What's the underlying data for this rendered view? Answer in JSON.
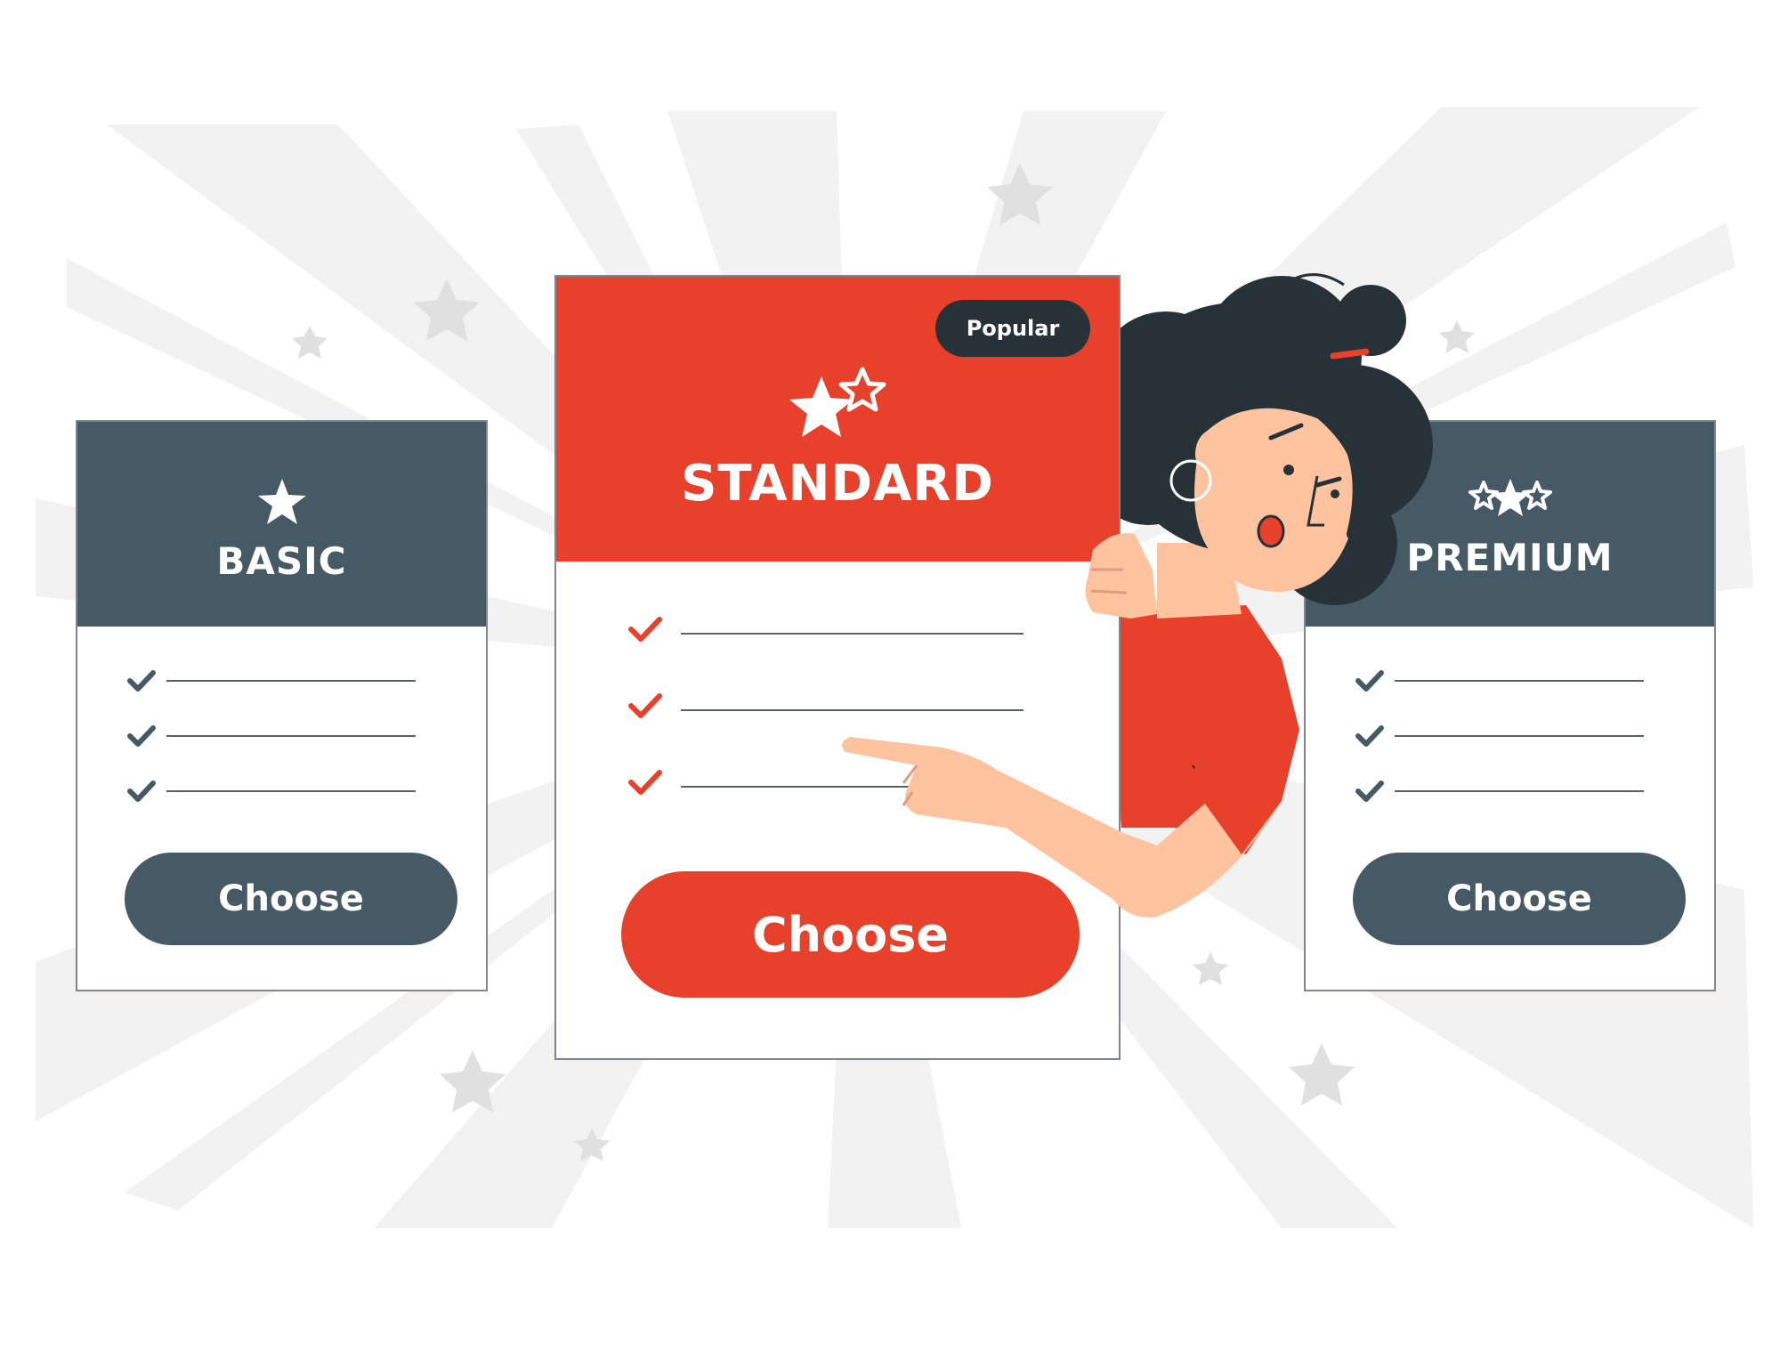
{
  "colors": {
    "accent": "#e8412b",
    "dark_slate": "#455a64",
    "background_rays": "#f2f2f2",
    "star_gray": "#e0e0e0"
  },
  "plans": {
    "basic": {
      "title": "BASIC",
      "icon": "one-star-icon",
      "feature_count": 3,
      "button_label": "Choose"
    },
    "standard": {
      "title": "STANDARD",
      "icon": "two-stars-icon",
      "badge": "Popular",
      "feature_count": 3,
      "button_label": "Choose"
    },
    "premium": {
      "title": "PREMIUM",
      "icon": "three-stars-icon",
      "feature_count": 3,
      "button_label": "Choose"
    }
  },
  "illustration": {
    "character": "woman-pointing-illustration"
  }
}
